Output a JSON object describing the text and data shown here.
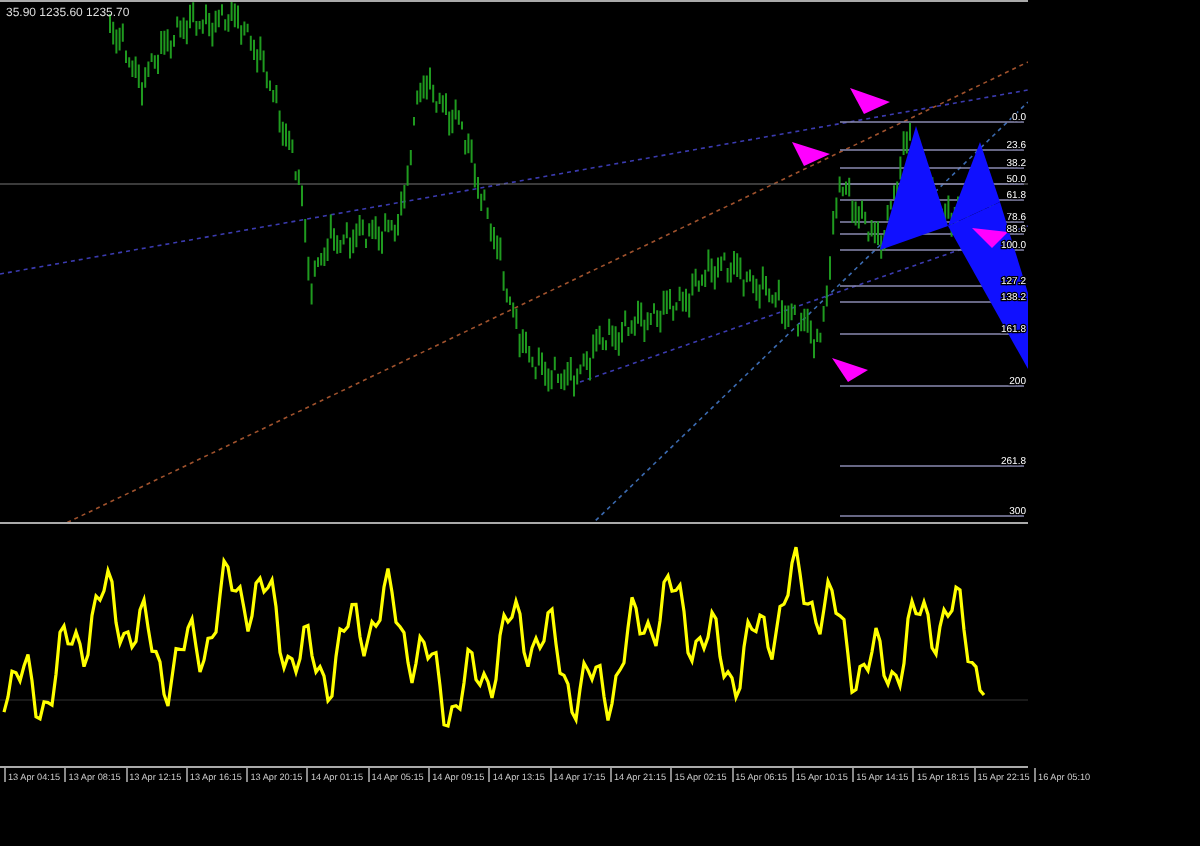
{
  "price_chart": {
    "header": "35.90 1235.60 1235.70",
    "fib_levels": [
      {
        "label": "0.0"
      },
      {
        "label": "23.6"
      },
      {
        "label": "38.2"
      },
      {
        "label": "50.0"
      },
      {
        "label": "61.8"
      },
      {
        "label": "78.6"
      },
      {
        "label": "88.6"
      },
      {
        "label": "100.0"
      },
      {
        "label": "127.2"
      },
      {
        "label": "138.2"
      },
      {
        "label": "161.8"
      },
      {
        "label": "200"
      },
      {
        "label": "261.8"
      },
      {
        "label": "300"
      }
    ]
  },
  "time_axis": {
    "labels": [
      "13 Apr 04:15",
      "13 Apr 08:15",
      "13 Apr 12:15",
      "13 Apr 16:15",
      "13 Apr 20:15",
      "14 Apr 01:15",
      "14 Apr 05:15",
      "14 Apr 09:15",
      "14 Apr 13:15",
      "14 Apr 17:15",
      "14 Apr 21:15",
      "15 Apr 02:15",
      "15 Apr 06:15",
      "15 Apr 10:15",
      "15 Apr 14:15",
      "15 Apr 18:15",
      "15 Apr 22:15",
      "16 Apr 05:10"
    ]
  }
}
